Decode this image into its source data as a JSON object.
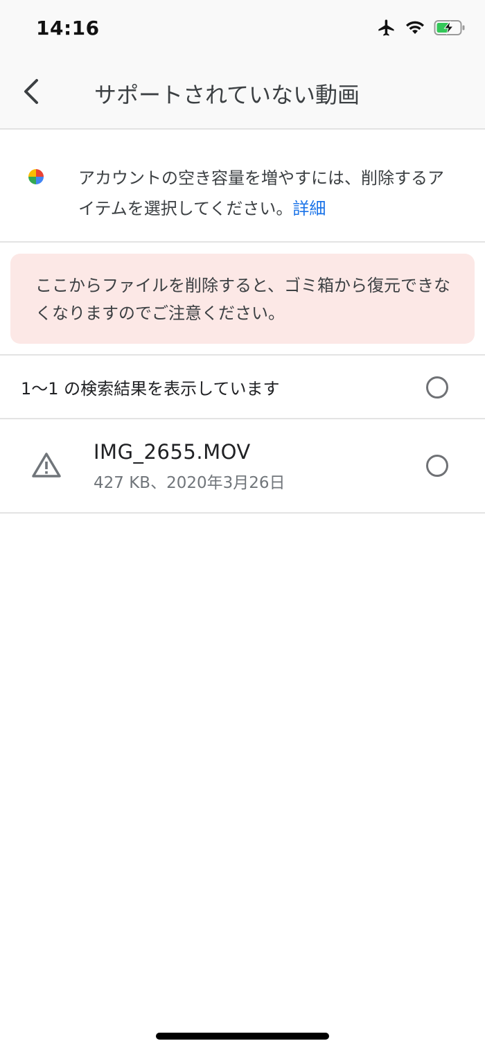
{
  "status_bar": {
    "time": "14:16",
    "icons": [
      "airplane-icon",
      "wifi-icon",
      "battery-charging-icon"
    ]
  },
  "header": {
    "back_icon": "chevron-left-icon",
    "title": "サポートされていない動画"
  },
  "info": {
    "logo": "google-photos-pinwheel-icon",
    "text": "アカウントの空き容量を増やすには、削除するアイテムを選択してください。",
    "link_label": "詳細"
  },
  "warning": {
    "text": "ここからファイルを削除すると、ゴミ箱から復元できなくなりますのでご注意ください。"
  },
  "results": {
    "summary": "1〜1 の検索結果を表示しています",
    "select_all_checked": false
  },
  "files": [
    {
      "icon": "warning-triangle-icon",
      "name": "IMG_2655.MOV",
      "meta": "427 KB、2020年3月26日",
      "checked": false
    }
  ],
  "colors": {
    "link": "#1a73e8",
    "warning_bg": "#fce8e6",
    "divider": "#e3e3e3",
    "header_bg": "#f9f9f9",
    "battery_green": "#34c759"
  }
}
